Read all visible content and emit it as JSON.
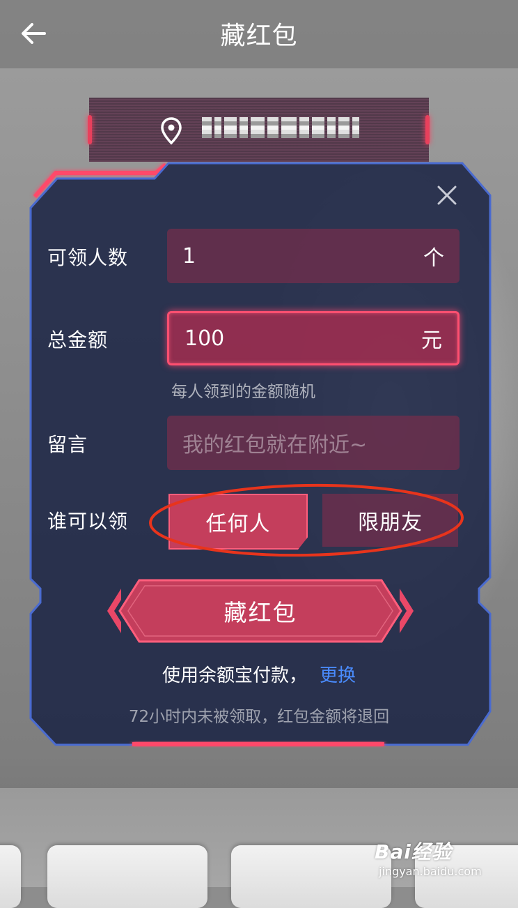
{
  "header": {
    "title": "藏红包"
  },
  "location": {
    "text": ""
  },
  "form": {
    "count_label": "可领人数",
    "count_value": "1",
    "count_unit": "个",
    "amount_label": "总金额",
    "amount_value": "100",
    "amount_unit": "元",
    "amount_hint": "每人领到的金额随机",
    "message_label": "留言",
    "message_placeholder": "我的红包就在附近~",
    "who_label": "谁可以领",
    "options": [
      "任何人",
      "限朋友"
    ],
    "selected_option": "任何人"
  },
  "submit": {
    "label": "藏红包"
  },
  "payment": {
    "text": "使用余额宝付款，",
    "change_label": "更换"
  },
  "note": "72小时内未被领取，红包金额将退回",
  "watermark": {
    "brand": "Bai经验",
    "url": "jingyan.baidu.com"
  },
  "colors": {
    "accent": "#ff4f70",
    "panel": "#1f2a4a",
    "panel_border": "#4a6bd0",
    "link": "#4a8cff",
    "annotation": "#e8341c"
  }
}
